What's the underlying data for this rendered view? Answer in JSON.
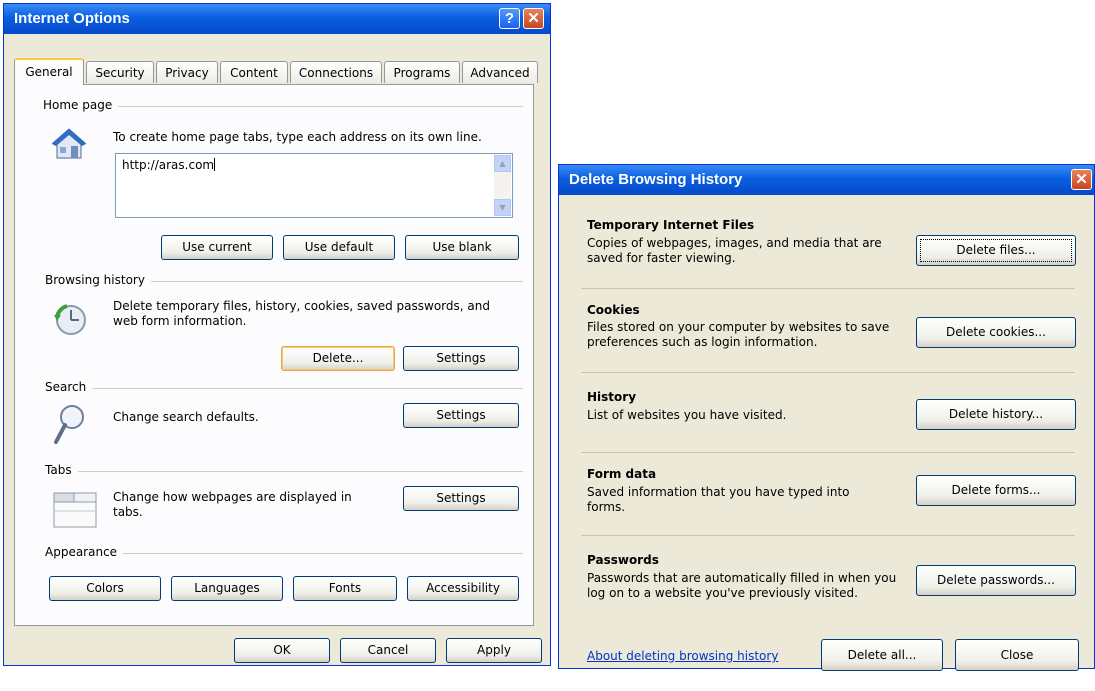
{
  "internet_options": {
    "title": "Internet Options",
    "help_glyph": "?",
    "close_glyph": "✕",
    "tabs": [
      "General",
      "Security",
      "Privacy",
      "Content",
      "Connections",
      "Programs",
      "Advanced"
    ],
    "home_page": {
      "label": "Home page",
      "description": "To create home page tabs, type each address on its own line.",
      "url_value": "http://aras.com",
      "use_current": "Use current",
      "use_default": "Use default",
      "use_blank": "Use blank"
    },
    "browsing_history": {
      "label": "Browsing history",
      "description": "Delete temporary files, history, cookies, saved passwords, and web form information.",
      "delete": "Delete...",
      "settings": "Settings"
    },
    "search": {
      "label": "Search",
      "description": "Change search defaults.",
      "settings": "Settings"
    },
    "tabs_section": {
      "label": "Tabs",
      "description": "Change how webpages are displayed in tabs.",
      "settings": "Settings"
    },
    "appearance": {
      "label": "Appearance",
      "colors": "Colors",
      "languages": "Languages",
      "fonts": "Fonts",
      "accessibility": "Accessibility"
    },
    "footer": {
      "ok": "OK",
      "cancel": "Cancel",
      "apply": "Apply"
    }
  },
  "delete_history": {
    "title": "Delete Browsing History",
    "close_glyph": "✕",
    "sections": [
      {
        "heading": "Temporary Internet Files",
        "description": "Copies of webpages, images, and media that are saved for faster viewing.",
        "button": "Delete files..."
      },
      {
        "heading": "Cookies",
        "description": "Files stored on your computer by websites to save preferences such as login information.",
        "button": "Delete cookies..."
      },
      {
        "heading": "History",
        "description": "List of websites you have visited.",
        "button": "Delete history..."
      },
      {
        "heading": "Form data",
        "description": "Saved information that you have typed into forms.",
        "button": "Delete forms..."
      },
      {
        "heading": "Passwords",
        "description": "Passwords that are automatically filled in when you log on to a website you've previously visited.",
        "button": "Delete passwords..."
      }
    ],
    "about_link": "About deleting browsing history",
    "delete_all": "Delete all...",
    "close": "Close"
  },
  "colors": {
    "title_bar": "#0a5fe0",
    "dialog_bg": "#ece9d8",
    "panel_bg": "#fcfcfe",
    "link": "#0033cc",
    "focus_border": "#e3a64a"
  }
}
